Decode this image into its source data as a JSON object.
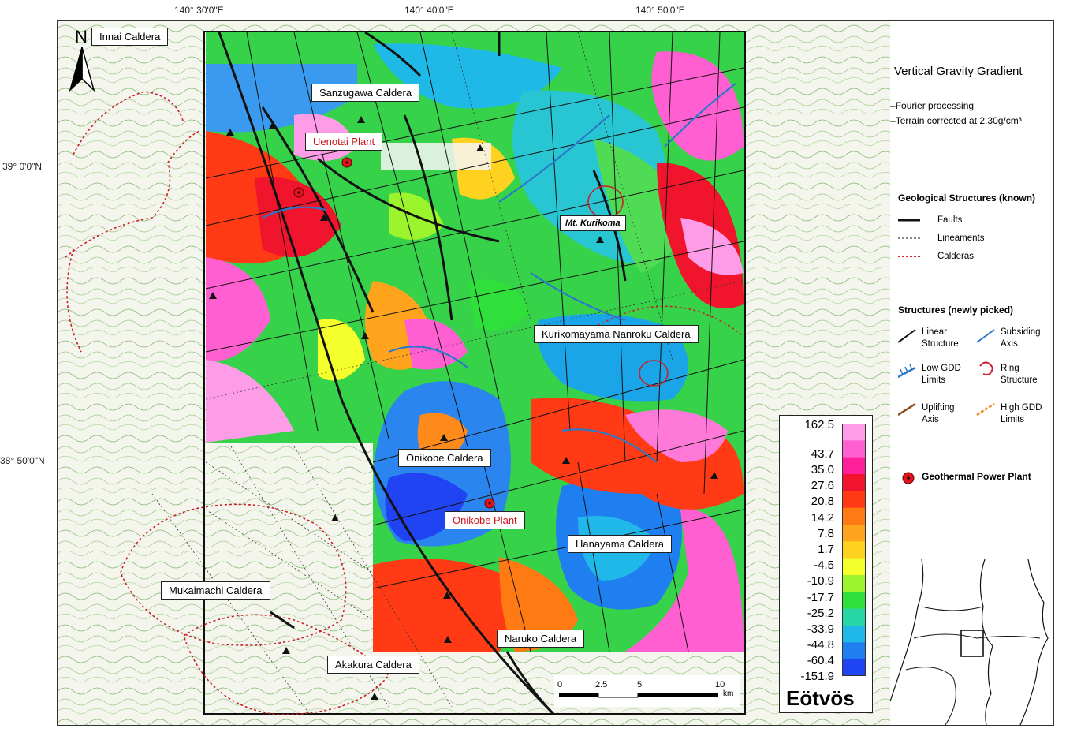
{
  "coordinates": {
    "top": [
      "140° 30'0\"E",
      "140° 40'0\"E",
      "140° 50'0\"E"
    ],
    "left": [
      "39° 0'0\"N",
      "38° 50'0\"N"
    ]
  },
  "north_arrow": {
    "label": "N"
  },
  "callouts": {
    "innai": "Innai Caldera",
    "sanzugawa": "Sanzugawa Caldera",
    "uenotai": "Uenotai Plant",
    "kurikoma": "Mt. Kurikoma",
    "nanroku": "Kurikomayama  Nanroku Caldera",
    "onikobe_caldera": "Onikobe Caldera",
    "onikobe_plant": "Onikobe  Plant",
    "hanayama": "Hanayama Caldera",
    "mukaimachi": "Mukaimachi Caldera",
    "naruko": "Naruko Caldera",
    "akakura": "Akakura Caldera"
  },
  "legend": {
    "title": "Vertical Gravity Gradient",
    "note1": "Fourier processing",
    "note2": "Terrain corrected at 2.30g/cm³",
    "known_head": "Geological Structures (known)",
    "faults": "Faults",
    "lineaments": "Lineaments",
    "calderas": "Calderas",
    "new_head": "Structures (newly picked)",
    "linear_1": "Linear",
    "linear_2": "Structure",
    "subsiding_1": "Subsiding",
    "subsiding_2": "Axis",
    "lowgdd_1": "Low GDD",
    "lowgdd_2": "Limits",
    "ring_1": "Ring",
    "ring_2": "Structure",
    "uplift_1": "Uplifting",
    "uplift_2": "Axis",
    "highgdd_1": "High GDD",
    "highgdd_2": "Limits",
    "plant": "Geothermal Power Plant"
  },
  "colorbar": {
    "values": [
      "162.5",
      "43.7",
      "35.0",
      "27.6",
      "20.8",
      "14.2",
      "7.8",
      "1.7",
      "-4.5",
      "-10.9",
      "-17.7",
      "-25.2",
      "-33.9",
      "-44.8",
      "-60.4",
      "-151.9"
    ],
    "unit": "Eötvös",
    "colors": [
      "#ff9ce8",
      "#ff5fd1",
      "#ff1f9a",
      "#f0142c",
      "#ff3a14",
      "#ff7a12",
      "#ffa41c",
      "#ffd21f",
      "#f4ff2c",
      "#9cf52c",
      "#2fe03a",
      "#27d6a5",
      "#20b8e8",
      "#1f7ff0",
      "#1f45f2"
    ]
  },
  "scalebar": {
    "ticks": [
      "0",
      "2.5",
      "5",
      "10"
    ],
    "unit": "km"
  },
  "colors": {
    "plant": "#e2131b",
    "fault": "#111111",
    "caldera": "#c8202a",
    "subsiding": "#2b78c8"
  }
}
